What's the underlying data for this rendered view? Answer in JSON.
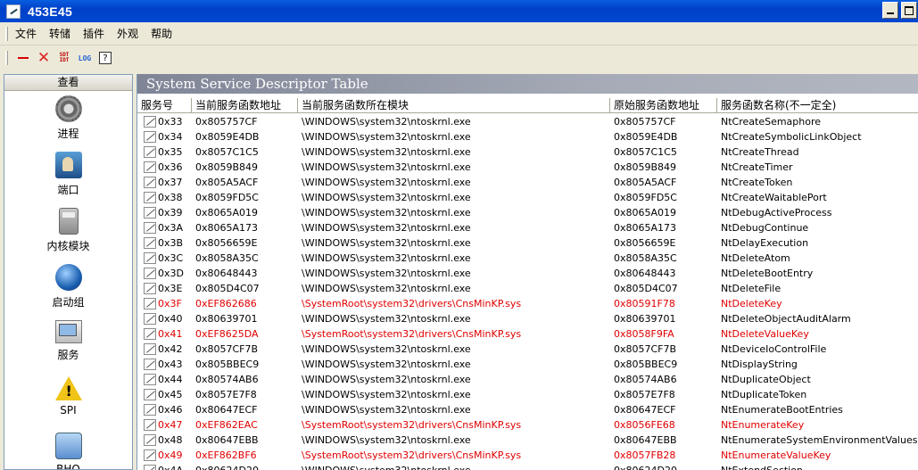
{
  "window": {
    "title": "453E45"
  },
  "menu": [
    "文件",
    "转储",
    "插件",
    "外观",
    "帮助"
  ],
  "toolbar": {
    "sdt_label": "SDT\nIDT",
    "log_label": "LOG",
    "help_label": "?"
  },
  "sidebar": {
    "header": "查看",
    "items": [
      {
        "label": "进程",
        "icon": "gear-icon"
      },
      {
        "label": "端口",
        "icon": "port-icon"
      },
      {
        "label": "内核模块",
        "icon": "module-icon"
      },
      {
        "label": "启动组",
        "icon": "boot-icon"
      },
      {
        "label": "服务",
        "icon": "service-icon"
      },
      {
        "label": "SPI",
        "icon": "warning-icon"
      },
      {
        "label": "BHO",
        "icon": "browser-icon"
      }
    ]
  },
  "panel": {
    "title": "System Service Descriptor Table"
  },
  "table": {
    "columns": [
      "服务号",
      "当前服务函数地址",
      "当前服务函数所在模块",
      "原始服务函数地址",
      "服务函数名称(不一定全)"
    ],
    "rows": [
      {
        "id": "0x33",
        "cur": "0x805757CF",
        "module": "\\WINDOWS\\system32\\ntoskrnl.exe",
        "orig": "0x805757CF",
        "name": "NtCreateSemaphore",
        "hooked": false
      },
      {
        "id": "0x34",
        "cur": "0x8059E4DB",
        "module": "\\WINDOWS\\system32\\ntoskrnl.exe",
        "orig": "0x8059E4DB",
        "name": "NtCreateSymbolicLinkObject",
        "hooked": false
      },
      {
        "id": "0x35",
        "cur": "0x8057C1C5",
        "module": "\\WINDOWS\\system32\\ntoskrnl.exe",
        "orig": "0x8057C1C5",
        "name": "NtCreateThread",
        "hooked": false
      },
      {
        "id": "0x36",
        "cur": "0x8059B849",
        "module": "\\WINDOWS\\system32\\ntoskrnl.exe",
        "orig": "0x8059B849",
        "name": "NtCreateTimer",
        "hooked": false
      },
      {
        "id": "0x37",
        "cur": "0x805A5ACF",
        "module": "\\WINDOWS\\system32\\ntoskrnl.exe",
        "orig": "0x805A5ACF",
        "name": "NtCreateToken",
        "hooked": false
      },
      {
        "id": "0x38",
        "cur": "0x8059FD5C",
        "module": "\\WINDOWS\\system32\\ntoskrnl.exe",
        "orig": "0x8059FD5C",
        "name": "NtCreateWaitablePort",
        "hooked": false
      },
      {
        "id": "0x39",
        "cur": "0x8065A019",
        "module": "\\WINDOWS\\system32\\ntoskrnl.exe",
        "orig": "0x8065A019",
        "name": "NtDebugActiveProcess",
        "hooked": false
      },
      {
        "id": "0x3A",
        "cur": "0x8065A173",
        "module": "\\WINDOWS\\system32\\ntoskrnl.exe",
        "orig": "0x8065A173",
        "name": "NtDebugContinue",
        "hooked": false
      },
      {
        "id": "0x3B",
        "cur": "0x8056659E",
        "module": "\\WINDOWS\\system32\\ntoskrnl.exe",
        "orig": "0x8056659E",
        "name": "NtDelayExecution",
        "hooked": false
      },
      {
        "id": "0x3C",
        "cur": "0x8058A35C",
        "module": "\\WINDOWS\\system32\\ntoskrnl.exe",
        "orig": "0x8058A35C",
        "name": "NtDeleteAtom",
        "hooked": false
      },
      {
        "id": "0x3D",
        "cur": "0x80648443",
        "module": "\\WINDOWS\\system32\\ntoskrnl.exe",
        "orig": "0x80648443",
        "name": "NtDeleteBootEntry",
        "hooked": false
      },
      {
        "id": "0x3E",
        "cur": "0x805D4C07",
        "module": "\\WINDOWS\\system32\\ntoskrnl.exe",
        "orig": "0x805D4C07",
        "name": "NtDeleteFile",
        "hooked": false
      },
      {
        "id": "0x3F",
        "cur": "0xEF862686",
        "module": "\\SystemRoot\\system32\\drivers\\CnsMinKP.sys",
        "orig": "0x80591F78",
        "name": "NtDeleteKey",
        "hooked": true
      },
      {
        "id": "0x40",
        "cur": "0x80639701",
        "module": "\\WINDOWS\\system32\\ntoskrnl.exe",
        "orig": "0x80639701",
        "name": "NtDeleteObjectAuditAlarm",
        "hooked": false
      },
      {
        "id": "0x41",
        "cur": "0xEF8625DA",
        "module": "\\SystemRoot\\system32\\drivers\\CnsMinKP.sys",
        "orig": "0x8058F9FA",
        "name": "NtDeleteValueKey",
        "hooked": true
      },
      {
        "id": "0x42",
        "cur": "0x8057CF7B",
        "module": "\\WINDOWS\\system32\\ntoskrnl.exe",
        "orig": "0x8057CF7B",
        "name": "NtDeviceIoControlFile",
        "hooked": false
      },
      {
        "id": "0x43",
        "cur": "0x805BBEC9",
        "module": "\\WINDOWS\\system32\\ntoskrnl.exe",
        "orig": "0x805BBEC9",
        "name": "NtDisplayString",
        "hooked": false
      },
      {
        "id": "0x44",
        "cur": "0x80574AB6",
        "module": "\\WINDOWS\\system32\\ntoskrnl.exe",
        "orig": "0x80574AB6",
        "name": "NtDuplicateObject",
        "hooked": false
      },
      {
        "id": "0x45",
        "cur": "0x8057E7F8",
        "module": "\\WINDOWS\\system32\\ntoskrnl.exe",
        "orig": "0x8057E7F8",
        "name": "NtDuplicateToken",
        "hooked": false
      },
      {
        "id": "0x46",
        "cur": "0x80647ECF",
        "module": "\\WINDOWS\\system32\\ntoskrnl.exe",
        "orig": "0x80647ECF",
        "name": "NtEnumerateBootEntries",
        "hooked": false
      },
      {
        "id": "0x47",
        "cur": "0xEF862EAC",
        "module": "\\SystemRoot\\system32\\drivers\\CnsMinKP.sys",
        "orig": "0x8056FE68",
        "name": "NtEnumerateKey",
        "hooked": true
      },
      {
        "id": "0x48",
        "cur": "0x80647EBB",
        "module": "\\WINDOWS\\system32\\ntoskrnl.exe",
        "orig": "0x80647EBB",
        "name": "NtEnumerateSystemEnvironmentValuesEx",
        "hooked": false
      },
      {
        "id": "0x49",
        "cur": "0xEF862BF6",
        "module": "\\SystemRoot\\system32\\drivers\\CnsMinKP.sys",
        "orig": "0x8057FB28",
        "name": "NtEnumerateValueKey",
        "hooked": true
      },
      {
        "id": "0x4A",
        "cur": "0x80624D20",
        "module": "\\WINDOWS\\system32\\ntoskrnl.exe",
        "orig": "0x80624D20",
        "name": "NtExtendSection",
        "hooked": false
      }
    ]
  }
}
